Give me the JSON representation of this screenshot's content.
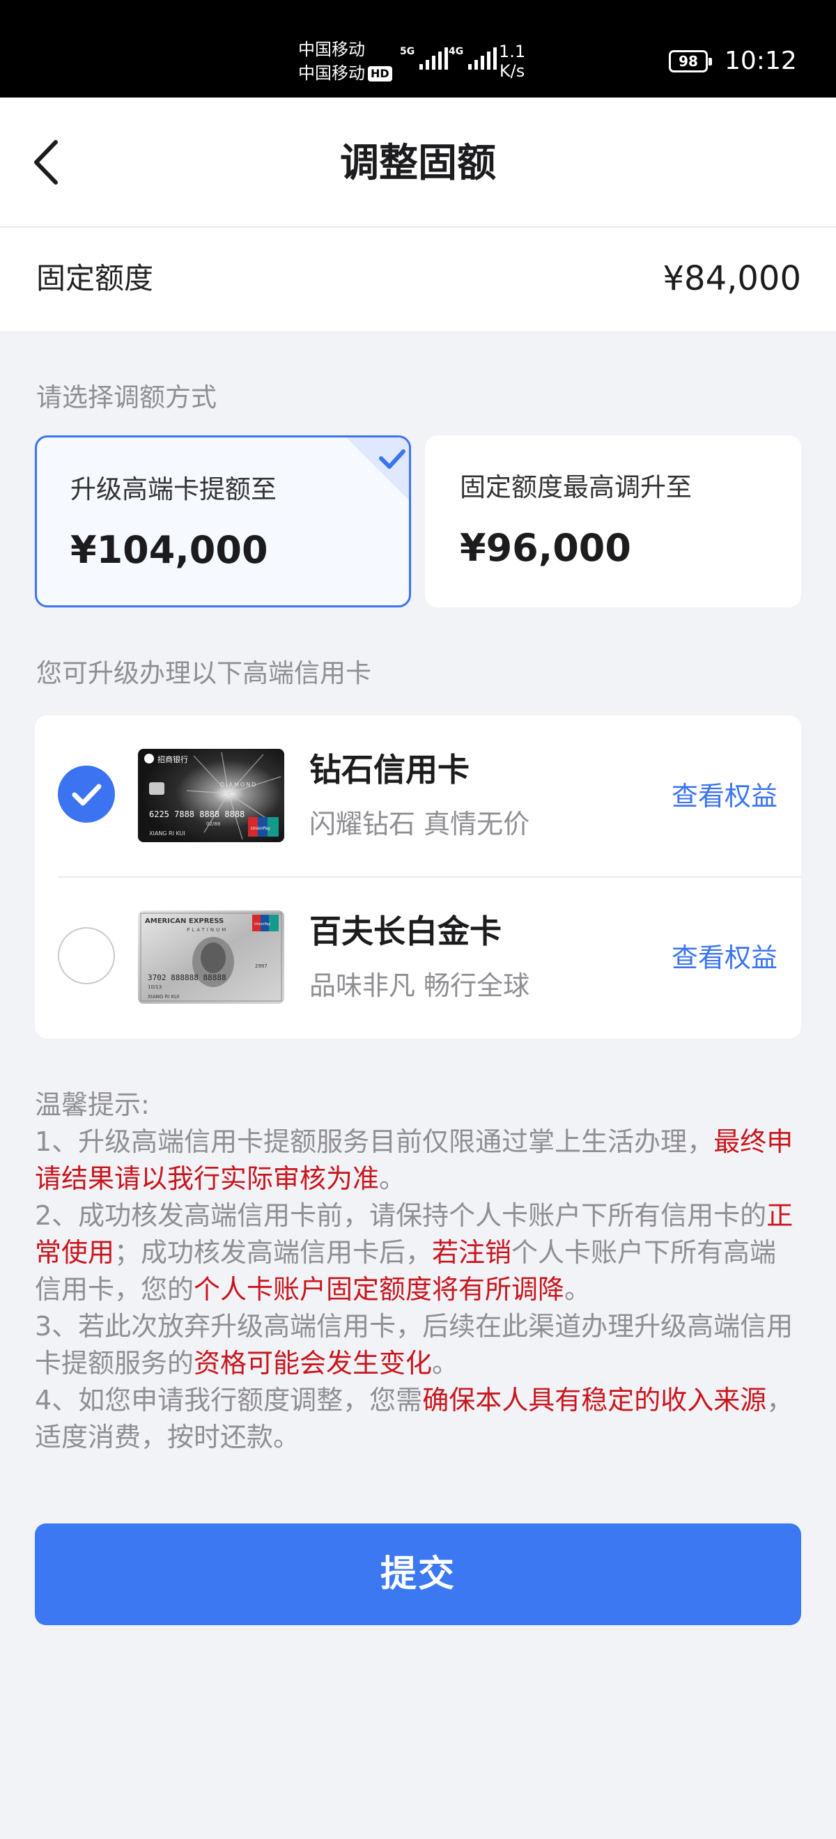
{
  "status_bar": {
    "carrier_1": "中国移动",
    "carrier_2": "中国移动",
    "hd": "HD",
    "net_1": "5G",
    "net_2": "4G",
    "speed_value": "1.1",
    "speed_unit": "K/s",
    "battery": "98",
    "time": "10:12"
  },
  "header": {
    "title": "调整固额",
    "back_icon": "chevron-left-icon"
  },
  "fixed": {
    "label": "固定额度",
    "value": "¥84,000"
  },
  "method": {
    "label": "请选择调额方式",
    "options": [
      {
        "title": "升级高端卡提额至",
        "amount": "¥104,000",
        "selected": true
      },
      {
        "title": "固定额度最高调升至",
        "amount": "¥96,000",
        "selected": false
      }
    ]
  },
  "cards": {
    "label": "您可升级办理以下高端信用卡",
    "items": [
      {
        "name": "钻石信用卡",
        "desc": "闪耀钻石 真情无价",
        "link": "查看权益",
        "selected": true,
        "card_bank": "招商银行",
        "card_brand": "DIAMOND",
        "card_number": "6225 7888 8888 8888",
        "card_holder": "XIANG RI KUI",
        "card_expiry": "02/88",
        "card_network": "UnionPay"
      },
      {
        "name": "百夫长白金卡",
        "desc": "品味非凡 畅行全球",
        "link": "查看权益",
        "selected": false,
        "card_brand": "AMERICAN EXPRESS",
        "card_sub": "PLATINUM",
        "card_number": "3702 888888 88888",
        "card_holder": "XIANG RI KUI",
        "card_expiry": "10/13",
        "card_code": "2997",
        "card_network": "UnionPay"
      }
    ]
  },
  "tips": {
    "title": "温馨提示:",
    "t1_a": "1、升级高端信用卡提额服务目前仅限通过掌上生活办理，",
    "t1_b": "最终申请结果请以我行实际审核为准",
    "t1_c": "。",
    "t2_a": "2、成功核发高端信用卡前，请保持个人卡账户下所有信用卡的",
    "t2_b": "正常使用",
    "t2_c": "；成功核发高端信用卡后，",
    "t2_d": "若注销",
    "t2_e": "个人卡账户下所有高端信用卡，您的",
    "t2_f": "个人卡账户固定额度将有所调降",
    "t2_g": "。",
    "t3_a": "3、若此次放弃升级高端信用卡，后续在此渠道办理升级高端信用卡提额服务的",
    "t3_b": "资格可能会发生变化",
    "t3_c": "。",
    "t4_a": "4、如您申请我行额度调整，您需",
    "t4_b": "确保本人具有稳定的收入来源",
    "t4_c": "，适度消费，按时还款。"
  },
  "submit": {
    "label": "提交"
  },
  "colors": {
    "accent": "#3b73f1",
    "warning_red": "#c8161d",
    "muted": "#8e8e93"
  }
}
